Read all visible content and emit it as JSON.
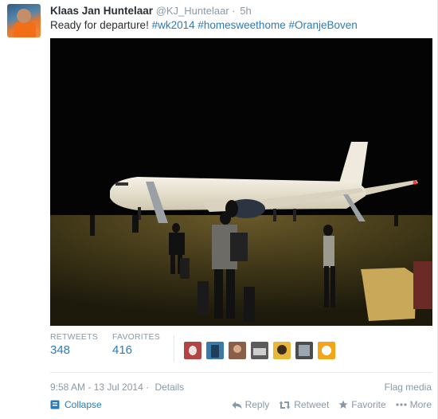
{
  "tweet": {
    "fullname": "Klaas Jan Huntelaar",
    "username": "@KJ_Huntelaar",
    "separator": "·",
    "time": "5h",
    "text_prefix": "Ready for departure! ",
    "hashtags": [
      "#wk2014",
      "#homesweethome",
      "#OranjeBoven"
    ]
  },
  "stats": {
    "retweets_label": "RETWEETS",
    "retweets_count": "348",
    "favorites_label": "FAVORITES",
    "favorites_count": "416",
    "favoriters_count_shown": 7
  },
  "meta": {
    "timestamp": "9:58 AM - 13 Jul 2014",
    "separator": "·",
    "details": "Details",
    "flag": "Flag media"
  },
  "actions": {
    "collapse": "Collapse",
    "reply": "Reply",
    "retweet": "Retweet",
    "favorite": "Favorite",
    "more": "More"
  },
  "icons": {
    "collapse": "collapse-icon",
    "reply": "reply-icon",
    "retweet": "retweet-icon",
    "favorite": "star-icon",
    "more": "ellipsis-icon"
  },
  "colors": {
    "link": "#2b7bb9",
    "muted": "#8899a6",
    "text": "#292f33"
  }
}
